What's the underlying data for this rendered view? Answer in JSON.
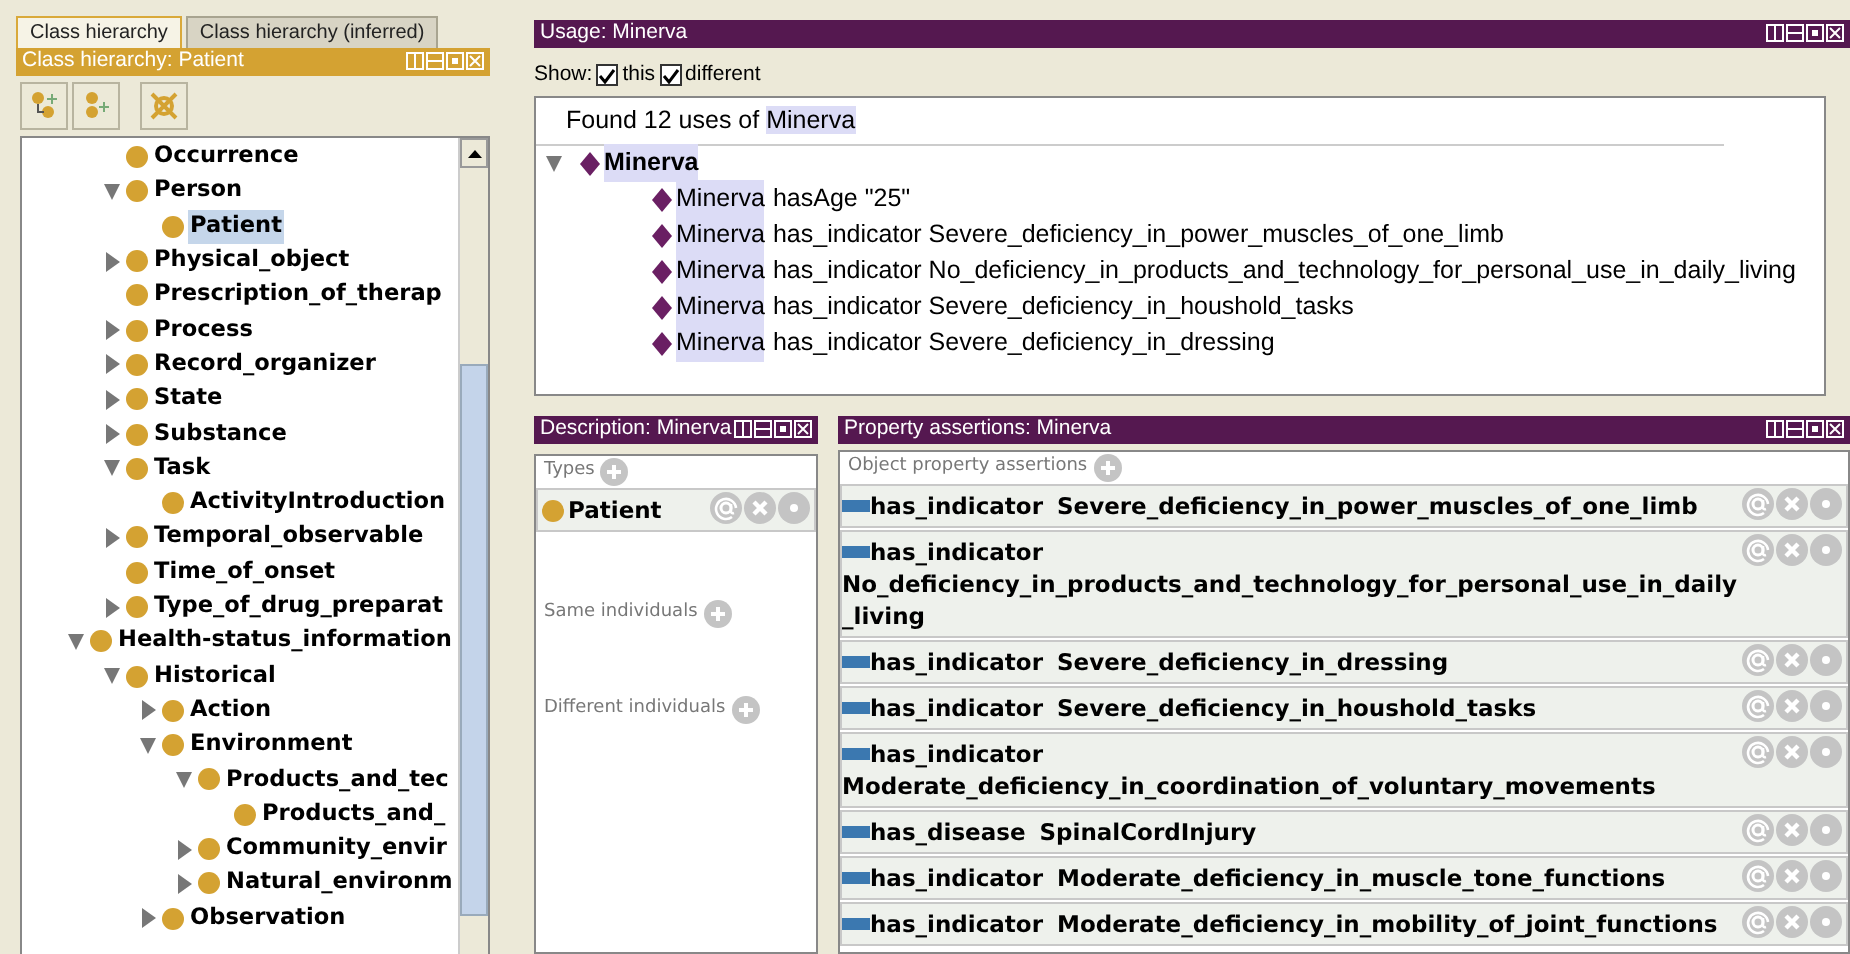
{
  "tabs": [
    {
      "label": "Class hierarchy",
      "selected": true
    },
    {
      "label": "Class hierarchy (inferred)",
      "selected": false
    }
  ],
  "class_panel": {
    "title": "Class hierarchy: Patient",
    "tree": [
      {
        "children": [
          {
            "label": "Occurrence",
            "selected": false
          },
          {
            "label": "Person",
            "selected": false,
            "expanded": true,
            "children": [
              {
                "label": "Patient",
                "selected": true
              }
            ]
          },
          {
            "label": "Physical_object",
            "selected": false,
            "expanded": false
          },
          {
            "label": "Prescription_of_therap",
            "selected": false
          },
          {
            "label": "Process",
            "selected": false,
            "expanded": false
          },
          {
            "label": "Record_organizer",
            "selected": false,
            "expanded": false
          },
          {
            "label": "State",
            "selected": false,
            "expanded": false
          },
          {
            "label": "Substance",
            "selected": false,
            "expanded": false
          },
          {
            "label": "Task",
            "selected": false,
            "expanded": true,
            "children": [
              {
                "label": "ActivityIntroduction",
                "selected": false
              }
            ]
          },
          {
            "label": "Temporal_observable",
            "selected": false,
            "expanded": false
          },
          {
            "label": "Time_of_onset",
            "selected": false
          },
          {
            "label": "Type_of_drug_preparat",
            "selected": false,
            "expanded": false
          }
        ]
      },
      {
        "label": "Health-status_information",
        "selected": false,
        "expanded": true,
        "children": [
          {
            "label": "Historical",
            "selected": false,
            "expanded": true,
            "children": [
              {
                "label": "Action",
                "selected": false,
                "expanded": false
              },
              {
                "label": "Environment",
                "selected": false,
                "expanded": true,
                "children": [
                  {
                    "label": "Products_and_tec",
                    "selected": false,
                    "expanded": true,
                    "children": [
                      {
                        "label": "Products_and_",
                        "selected": false
                      }
                    ]
                  },
                  {
                    "label": "Community_envir",
                    "selected": false,
                    "expanded": false
                  },
                  {
                    "label": "Natural_environm",
                    "selected": false,
                    "expanded": false
                  }
                ]
              },
              {
                "label": "Observation",
                "selected": false,
                "expanded": false
              }
            ]
          }
        ]
      }
    ]
  },
  "usage": {
    "title": "Usage: Minerva",
    "show_label": "Show:",
    "filters": [
      {
        "label": "this",
        "checked": true
      },
      {
        "label": "different",
        "checked": true
      }
    ],
    "found": {
      "prefix": "Found 12 uses of",
      "subject": "Minerva"
    },
    "root": {
      "label": "Minerva",
      "expanded": true,
      "children": [
        {
          "subject": "Minerva",
          "text": "hasAge \"25\""
        },
        {
          "subject": "Minerva",
          "text": "has_indicator Severe_deficiency_in_power_muscles_of_one_limb"
        },
        {
          "subject": "Minerva",
          "text": "has_indicator No_deficiency_in_products_and_technology_for_personal_use_in_daily_living"
        },
        {
          "subject": "Minerva",
          "text": "has_indicator Severe_deficiency_in_houshold_tasks"
        },
        {
          "subject": "Minerva",
          "text": "has_indicator Severe_deficiency_in_dressing"
        }
      ]
    }
  },
  "description": {
    "title": "Description: Minerva",
    "sections": [
      {
        "label": "Types",
        "items": [
          "Patient"
        ]
      },
      {
        "label": "Same individuals"
      },
      {
        "label": "Different individuals"
      }
    ]
  },
  "property_assertions": {
    "title": "Property assertions: Minerva",
    "section": "Object property assertions",
    "rows": [
      {
        "property": "has_indicator",
        "value": "Severe_deficiency_in_power_muscles_of_one_limb"
      },
      {
        "property": "has_indicator",
        "value": "No_deficiency_in_products_and_technology_for_personal_use_in_daily_living"
      },
      {
        "property": "has_indicator",
        "value": "Severe_deficiency_in_dressing"
      },
      {
        "property": "has_indicator",
        "value": "Severe_deficiency_in_houshold_tasks"
      },
      {
        "property": "has_indicator",
        "value": "Moderate_deficiency_in_coordination_of_voluntary_movements"
      },
      {
        "property": "has_disease",
        "value": "SpinalCordInjury"
      },
      {
        "property": "has_indicator",
        "value": "Moderate_deficiency_in_muscle_tone_functions"
      },
      {
        "property": "has_indicator",
        "value": "Moderate_deficiency_in_mobility_of_joint_functions"
      }
    ]
  }
}
